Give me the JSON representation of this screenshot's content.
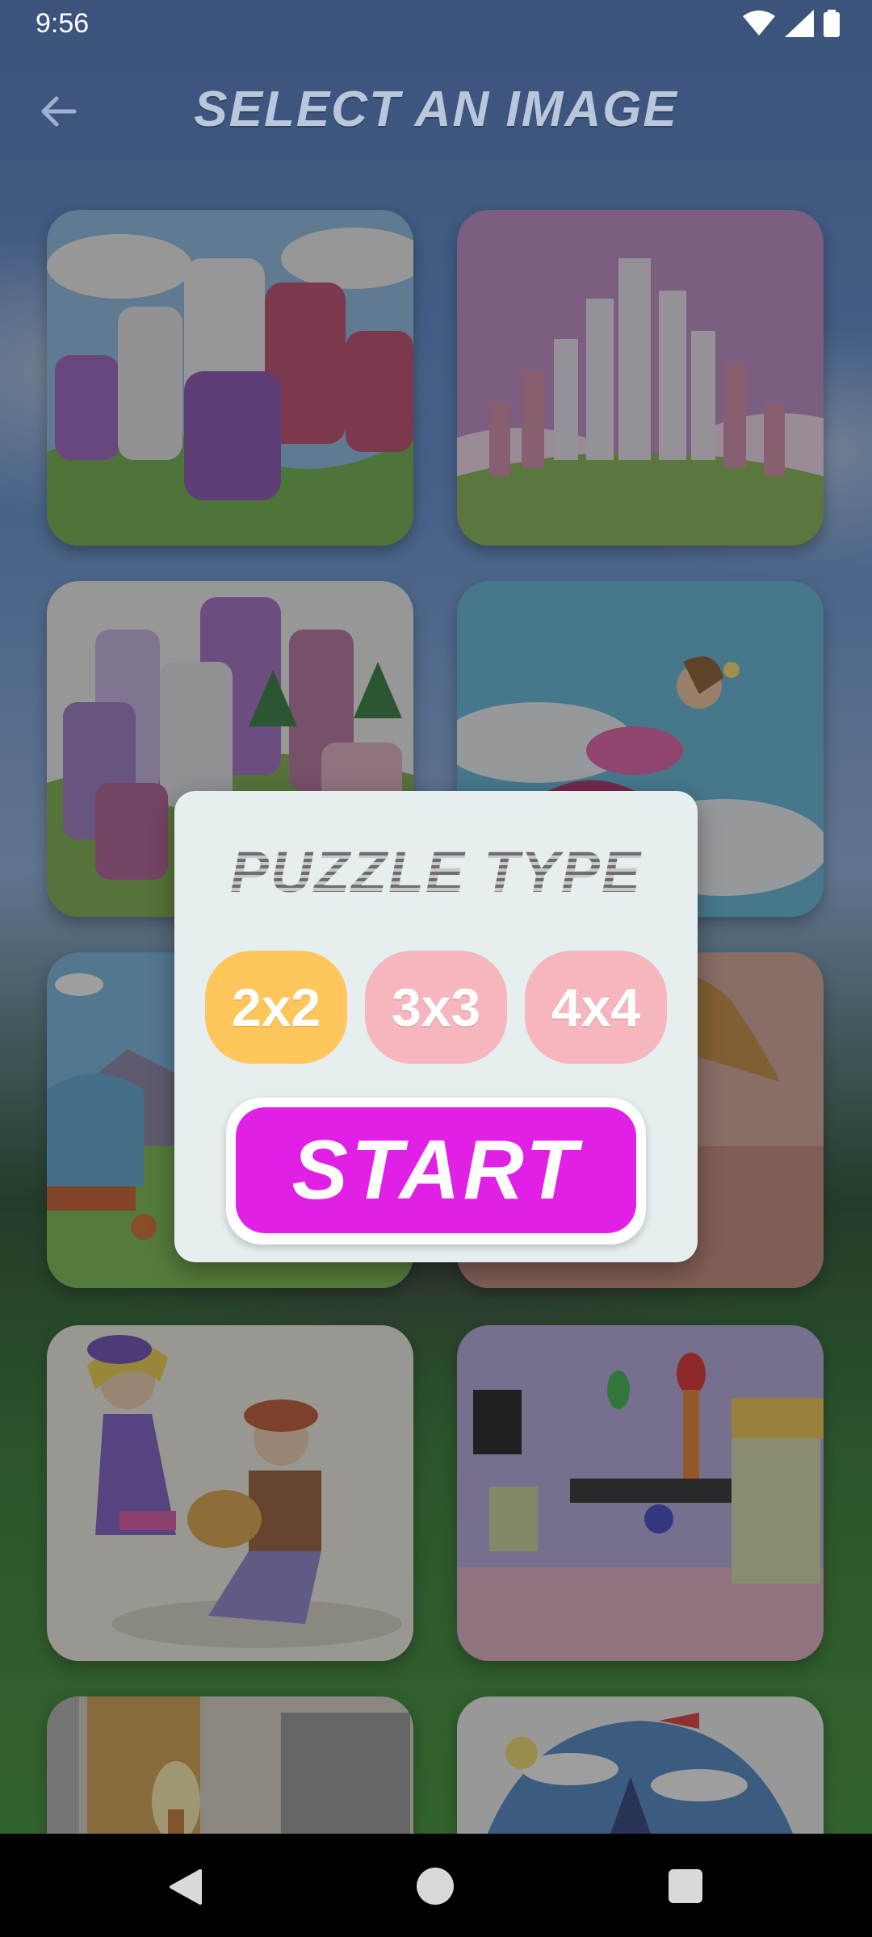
{
  "status_bar": {
    "time": "9:56"
  },
  "header": {
    "title": "SELECT AN IMAGE",
    "back_icon": "arrow-left-icon"
  },
  "grid": {
    "images": [
      "purple-white-candles-hills",
      "candle-castle-pink-sky",
      "candles-forest-hill",
      "superhero-girl-flying",
      "fairground-cartoon",
      "girl-with-long-hair",
      "dancing-girl-and-painter",
      "candle-shop-interior",
      "lit-candle-closeup",
      "castle-with-airplane"
    ]
  },
  "dialog": {
    "title": "PUZZLE TYPE",
    "options": [
      {
        "label": "2x2",
        "selected": true
      },
      {
        "label": "3x3",
        "selected": false
      },
      {
        "label": "4x4",
        "selected": false
      }
    ],
    "start_label": "START"
  },
  "colors": {
    "selected_option": "#fec65b",
    "unselected_option": "#f5b6bd",
    "start_button": "#e020e4",
    "dialog_bg": "#e6eef0"
  }
}
